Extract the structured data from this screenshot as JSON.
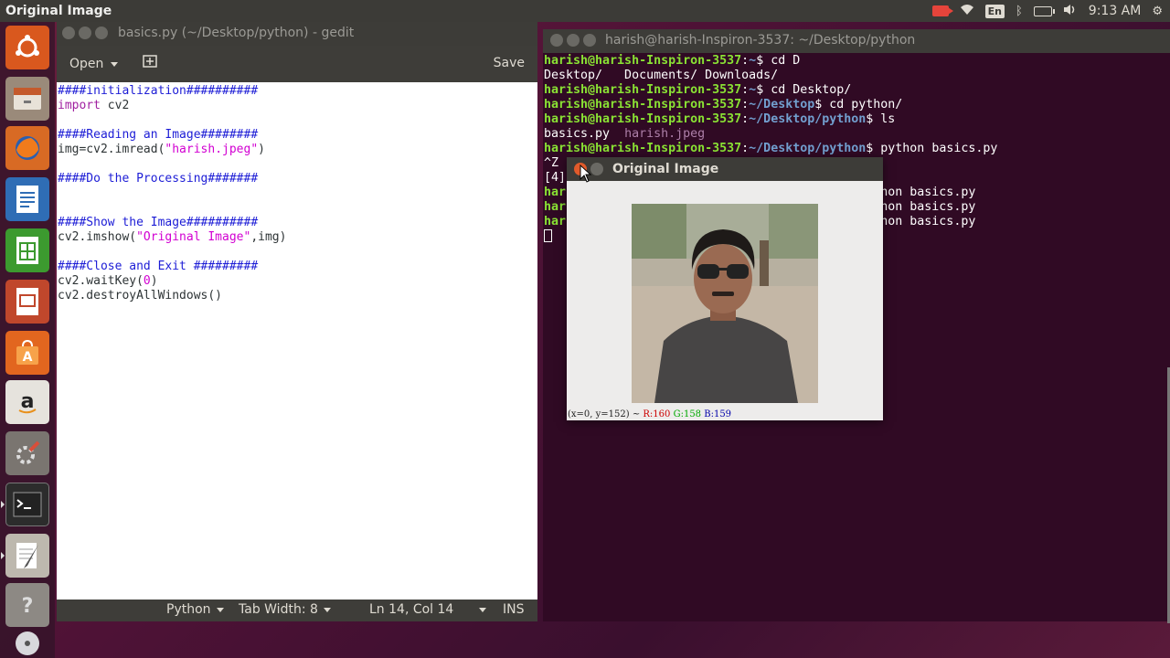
{
  "top_panel": {
    "app_title": "Original Image",
    "lang": "En",
    "clock": "9:13 AM"
  },
  "launcher": {
    "items": [
      "ubuntu-dash",
      "files",
      "firefox",
      "libreoffice-writer",
      "libreoffice-calc",
      "libreoffice-impress",
      "software-center",
      "amazon",
      "system-settings",
      "terminal",
      "gedit",
      "help",
      "dvd-drive"
    ]
  },
  "gedit": {
    "title": "basics.py (~/Desktop/python) - gedit",
    "open_label": "Open",
    "save_label": "Save",
    "status": {
      "language": "Python",
      "tab_width": "Tab Width: 8",
      "position": "Ln 14, Col 14",
      "mode": "INS"
    }
  },
  "terminal": {
    "title": "harish@harish-Inspiron-3537: ~/Desktop/python"
  },
  "cv_window": {
    "title": "Original Image",
    "status_coords": "(x=0, y=152) ~",
    "status_r": "R:160",
    "status_g": "G:158",
    "status_b": "B:159"
  },
  "colors": {
    "terminal_bg": "#300a24",
    "prompt_user": "#8ae234",
    "prompt_path": "#729fcf",
    "comment": "#1d1dd6",
    "keyword": "#a020a0",
    "string": "#d200d2"
  }
}
